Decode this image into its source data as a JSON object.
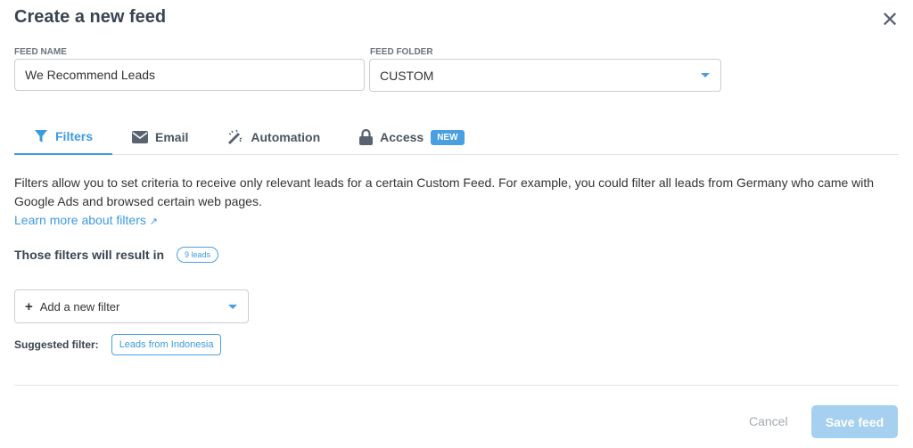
{
  "header": {
    "title": "Create a new feed",
    "close_icon": "close-icon"
  },
  "form": {
    "feed_name_label": "FEED NAME",
    "feed_name_value": "We Recommend Leads",
    "feed_folder_label": "FEED FOLDER",
    "feed_folder_value": "CUSTOM"
  },
  "tabs": [
    {
      "label": "Filters",
      "icon": "filter-icon",
      "active": true
    },
    {
      "label": "Email",
      "icon": "envelope-icon"
    },
    {
      "label": "Automation",
      "icon": "magic-wand-icon"
    },
    {
      "label": "Access",
      "icon": "lock-icon",
      "badge": "NEW"
    }
  ],
  "filters": {
    "description": "Filters allow you to set criteria to receive only relevant leads for a certain Custom Feed. For example, you could filter all leads from Germany who came with Google Ads and browsed certain web pages.",
    "learn_more": "Learn more about filters",
    "result_label": "Those filters will result in",
    "result_count": "9 leads",
    "add_filter": "Add a new filter",
    "suggested_label": "Suggested filter:",
    "suggested_value": "Leads from Indonesia"
  },
  "footer": {
    "cancel": "Cancel",
    "save": "Save feed"
  },
  "colors": {
    "accent": "#3c9be0",
    "save_disabled": "#a6d0f0"
  }
}
